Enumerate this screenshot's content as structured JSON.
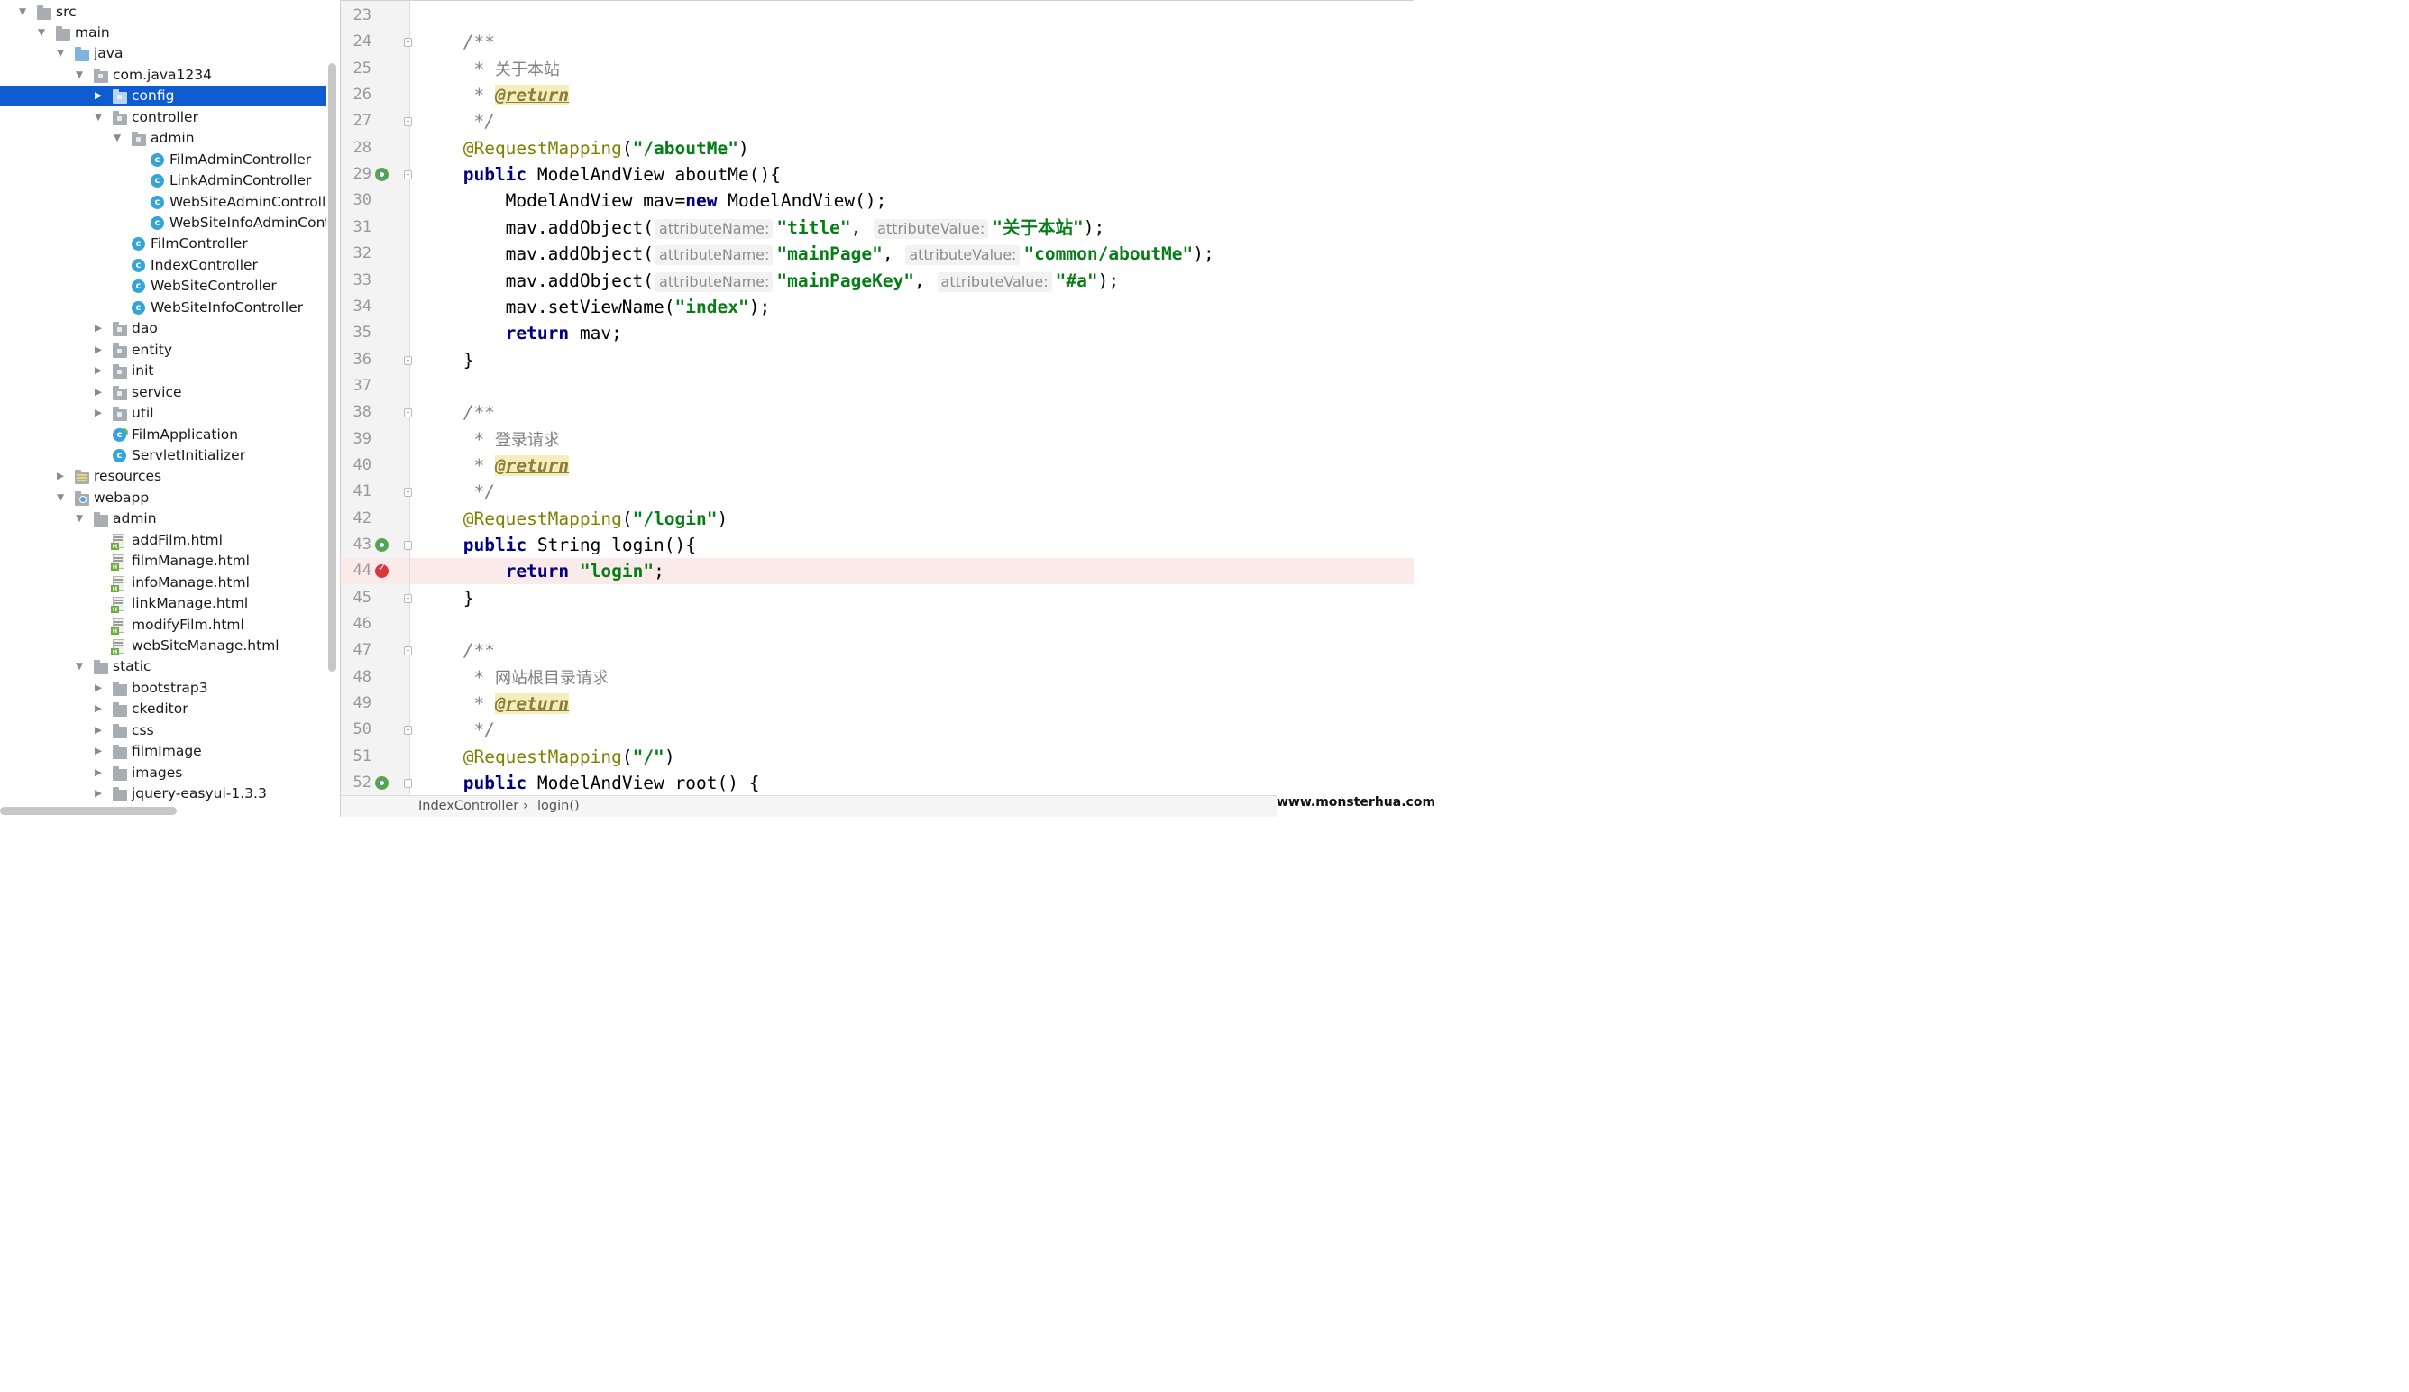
{
  "project_tree": [
    {
      "depth": 0,
      "expanded": true,
      "icon": "folder",
      "label": "src"
    },
    {
      "depth": 1,
      "expanded": true,
      "icon": "folder",
      "label": "main"
    },
    {
      "depth": 2,
      "expanded": true,
      "icon": "folder-blue",
      "label": "java"
    },
    {
      "depth": 3,
      "expanded": true,
      "icon": "package",
      "label": "com.java1234"
    },
    {
      "depth": 4,
      "expanded": false,
      "icon": "package",
      "label": "config",
      "selected": true
    },
    {
      "depth": 4,
      "expanded": true,
      "icon": "package",
      "label": "controller"
    },
    {
      "depth": 5,
      "expanded": true,
      "icon": "package",
      "label": "admin"
    },
    {
      "depth": 6,
      "icon": "class",
      "label": "FilmAdminController"
    },
    {
      "depth": 6,
      "icon": "class",
      "label": "LinkAdminController"
    },
    {
      "depth": 6,
      "icon": "class",
      "label": "WebSiteAdminControlle"
    },
    {
      "depth": 6,
      "icon": "class",
      "label": "WebSiteInfoAdminContr"
    },
    {
      "depth": 5,
      "icon": "class",
      "label": "FilmController"
    },
    {
      "depth": 5,
      "icon": "class",
      "label": "IndexController"
    },
    {
      "depth": 5,
      "icon": "class",
      "label": "WebSiteController"
    },
    {
      "depth": 5,
      "icon": "class",
      "label": "WebSiteInfoController"
    },
    {
      "depth": 4,
      "expanded": false,
      "icon": "package",
      "label": "dao"
    },
    {
      "depth": 4,
      "expanded": false,
      "icon": "package",
      "label": "entity"
    },
    {
      "depth": 4,
      "expanded": false,
      "icon": "package",
      "label": "init"
    },
    {
      "depth": 4,
      "expanded": false,
      "icon": "package",
      "label": "service"
    },
    {
      "depth": 4,
      "expanded": false,
      "icon": "package",
      "label": "util"
    },
    {
      "depth": 4,
      "icon": "class-app",
      "label": "FilmApplication"
    },
    {
      "depth": 4,
      "icon": "class",
      "label": "ServletInitializer"
    },
    {
      "depth": 2,
      "expanded": false,
      "icon": "folder-res",
      "label": "resources"
    },
    {
      "depth": 2,
      "expanded": true,
      "icon": "folder-web",
      "label": "webapp"
    },
    {
      "depth": 3,
      "expanded": true,
      "icon": "folder",
      "label": "admin"
    },
    {
      "depth": 4,
      "icon": "html",
      "label": "addFilm.html"
    },
    {
      "depth": 4,
      "icon": "html",
      "label": "filmManage.html"
    },
    {
      "depth": 4,
      "icon": "html",
      "label": "infoManage.html"
    },
    {
      "depth": 4,
      "icon": "html",
      "label": "linkManage.html"
    },
    {
      "depth": 4,
      "icon": "html",
      "label": "modifyFilm.html"
    },
    {
      "depth": 4,
      "icon": "html",
      "label": "webSiteManage.html"
    },
    {
      "depth": 3,
      "expanded": true,
      "icon": "folder",
      "label": "static"
    },
    {
      "depth": 4,
      "expanded": false,
      "icon": "folder",
      "label": "bootstrap3"
    },
    {
      "depth": 4,
      "expanded": false,
      "icon": "folder",
      "label": "ckeditor"
    },
    {
      "depth": 4,
      "expanded": false,
      "icon": "folder",
      "label": "css"
    },
    {
      "depth": 4,
      "expanded": false,
      "icon": "folder",
      "label": "filmImage"
    },
    {
      "depth": 4,
      "expanded": false,
      "icon": "folder",
      "label": "images"
    },
    {
      "depth": 4,
      "expanded": false,
      "icon": "folder",
      "label": "jquery-easyui-1.3.3"
    }
  ],
  "editor": {
    "lines": [
      {
        "n": "23",
        "parts": []
      },
      {
        "n": "24",
        "fold": true,
        "parts": [
          {
            "t": "    "
          },
          {
            "t": "/**",
            "c": "c"
          }
        ]
      },
      {
        "n": "25",
        "parts": [
          {
            "t": "     "
          },
          {
            "t": "* ",
            "c": "c"
          },
          {
            "t": "关于本站",
            "c": "c cn"
          }
        ]
      },
      {
        "n": "26",
        "parts": [
          {
            "t": "     "
          },
          {
            "t": "* ",
            "c": "c"
          },
          {
            "t": "@return",
            "c": "tag"
          }
        ]
      },
      {
        "n": "27",
        "fold": true,
        "parts": [
          {
            "t": "     "
          },
          {
            "t": "*/",
            "c": "c"
          }
        ]
      },
      {
        "n": "28",
        "parts": [
          {
            "t": "    "
          },
          {
            "t": "@RequestMapping",
            "c": "a"
          },
          {
            "t": "("
          },
          {
            "t": "\"/aboutMe\"",
            "c": "s"
          },
          {
            "t": ")"
          }
        ]
      },
      {
        "n": "29",
        "marker": "run",
        "fold": true,
        "parts": [
          {
            "t": "    "
          },
          {
            "t": "public",
            "c": "k"
          },
          {
            "t": " ModelAndView aboutMe(){"
          }
        ]
      },
      {
        "n": "30",
        "parts": [
          {
            "t": "        ModelAndView mav="
          },
          {
            "t": "new",
            "c": "k"
          },
          {
            "t": " ModelAndView();"
          }
        ]
      },
      {
        "n": "31",
        "parts": [
          {
            "t": "        mav.addObject("
          },
          {
            "t": "attributeName:",
            "c": "hint"
          },
          {
            "t": "\"title\"",
            "c": "s"
          },
          {
            "t": ", "
          },
          {
            "t": "attributeValue:",
            "c": "hint"
          },
          {
            "t": "\"关于本站\"",
            "c": "s"
          },
          {
            "t": ");"
          }
        ]
      },
      {
        "n": "32",
        "parts": [
          {
            "t": "        mav.addObject("
          },
          {
            "t": "attributeName:",
            "c": "hint"
          },
          {
            "t": "\"mainPage\"",
            "c": "s"
          },
          {
            "t": ", "
          },
          {
            "t": "attributeValue:",
            "c": "hint"
          },
          {
            "t": "\"common/aboutMe\"",
            "c": "s"
          },
          {
            "t": ");"
          }
        ]
      },
      {
        "n": "33",
        "parts": [
          {
            "t": "        mav.addObject("
          },
          {
            "t": "attributeName:",
            "c": "hint"
          },
          {
            "t": "\"mainPageKey\"",
            "c": "s"
          },
          {
            "t": ", "
          },
          {
            "t": "attributeValue:",
            "c": "hint"
          },
          {
            "t": "\"#a\"",
            "c": "s"
          },
          {
            "t": ");"
          }
        ]
      },
      {
        "n": "34",
        "parts": [
          {
            "t": "        mav.setViewName("
          },
          {
            "t": "\"index\"",
            "c": "s"
          },
          {
            "t": ");"
          }
        ]
      },
      {
        "n": "35",
        "parts": [
          {
            "t": "        "
          },
          {
            "t": "return",
            "c": "k"
          },
          {
            "t": " mav;"
          }
        ]
      },
      {
        "n": "36",
        "fold": true,
        "parts": [
          {
            "t": "    }"
          }
        ]
      },
      {
        "n": "37",
        "parts": []
      },
      {
        "n": "38",
        "fold": true,
        "parts": [
          {
            "t": "    "
          },
          {
            "t": "/**",
            "c": "c"
          }
        ]
      },
      {
        "n": "39",
        "parts": [
          {
            "t": "     "
          },
          {
            "t": "* ",
            "c": "c"
          },
          {
            "t": "登录请求",
            "c": "c cn"
          }
        ]
      },
      {
        "n": "40",
        "parts": [
          {
            "t": "     "
          },
          {
            "t": "* ",
            "c": "c"
          },
          {
            "t": "@return",
            "c": "tag"
          }
        ]
      },
      {
        "n": "41",
        "fold": true,
        "parts": [
          {
            "t": "     "
          },
          {
            "t": "*/",
            "c": "c"
          }
        ]
      },
      {
        "n": "42",
        "parts": [
          {
            "t": "    "
          },
          {
            "t": "@RequestMapping",
            "c": "a"
          },
          {
            "t": "("
          },
          {
            "t": "\"/login\"",
            "c": "s"
          },
          {
            "t": ")"
          }
        ]
      },
      {
        "n": "43",
        "marker": "run",
        "fold": true,
        "parts": [
          {
            "t": "    "
          },
          {
            "t": "public",
            "c": "k"
          },
          {
            "t": " String login(){"
          }
        ]
      },
      {
        "n": "44",
        "marker": "breakpoint",
        "highlight": true,
        "parts": [
          {
            "t": "        "
          },
          {
            "t": "return",
            "c": "k"
          },
          {
            "t": " "
          },
          {
            "t": "\"login\"",
            "c": "s"
          },
          {
            "t": ";"
          }
        ]
      },
      {
        "n": "45",
        "fold": true,
        "parts": [
          {
            "t": "    }"
          }
        ]
      },
      {
        "n": "46",
        "parts": []
      },
      {
        "n": "47",
        "fold": true,
        "parts": [
          {
            "t": "    "
          },
          {
            "t": "/**",
            "c": "c"
          }
        ]
      },
      {
        "n": "48",
        "parts": [
          {
            "t": "     "
          },
          {
            "t": "* ",
            "c": "c"
          },
          {
            "t": "网站根目录请求",
            "c": "c cn"
          }
        ]
      },
      {
        "n": "49",
        "parts": [
          {
            "t": "     "
          },
          {
            "t": "* ",
            "c": "c"
          },
          {
            "t": "@return",
            "c": "tag"
          }
        ]
      },
      {
        "n": "50",
        "fold": true,
        "parts": [
          {
            "t": "     "
          },
          {
            "t": "*/",
            "c": "c"
          }
        ]
      },
      {
        "n": "51",
        "parts": [
          {
            "t": "    "
          },
          {
            "t": "@RequestMapping",
            "c": "a"
          },
          {
            "t": "("
          },
          {
            "t": "\"/\"",
            "c": "s"
          },
          {
            "t": ")"
          }
        ]
      },
      {
        "n": "52",
        "marker": "run",
        "fold": true,
        "parts": [
          {
            "t": "    "
          },
          {
            "t": "public",
            "c": "k"
          },
          {
            "t": " ModelAndView root() {"
          }
        ]
      }
    ]
  },
  "breadcrumb": {
    "class_name": "IndexController",
    "separator": "›",
    "method_name": "login()"
  },
  "watermark": "www.monsterhua.com",
  "colors": {
    "selection": "#0e5ccf",
    "keyword": "#000080",
    "string": "#067d17",
    "annotation": "#808000",
    "comment": "#808080",
    "breakpoint": "#d9363e",
    "current_line": "#fbeaea"
  }
}
